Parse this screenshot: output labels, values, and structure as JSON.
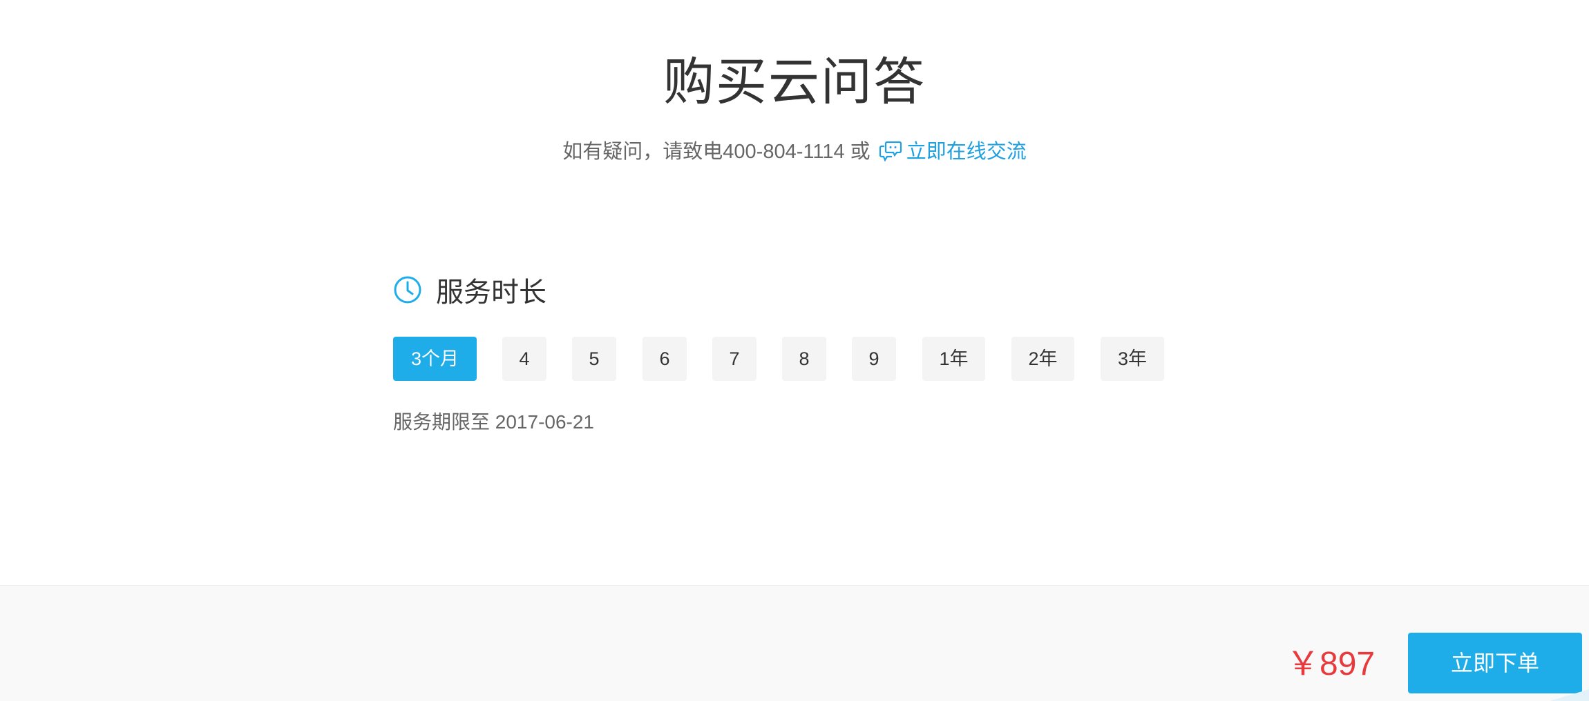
{
  "page": {
    "title": "购买云问答",
    "contact_prefix": "如有疑问，请致电400-804-1114 或",
    "chat_link": "立即在线交流"
  },
  "duration": {
    "heading": "服务时长",
    "options": [
      {
        "label": "3个月",
        "selected": true
      },
      {
        "label": "4",
        "selected": false
      },
      {
        "label": "5",
        "selected": false
      },
      {
        "label": "6",
        "selected": false
      },
      {
        "label": "7",
        "selected": false
      },
      {
        "label": "8",
        "selected": false
      },
      {
        "label": "9",
        "selected": false
      },
      {
        "label": "1年",
        "selected": false
      },
      {
        "label": "2年",
        "selected": false
      },
      {
        "label": "3年",
        "selected": false
      }
    ],
    "expiry_text": "服务期限至 2017-06-21"
  },
  "footer": {
    "price": "￥897",
    "order_button": "立即下单"
  },
  "colors": {
    "accent": "#1fadea",
    "price": "#e8393d",
    "text": "#333333",
    "muted": "#666666"
  },
  "icons": {
    "chat": "chat-bubble-icon",
    "clock": "clock-icon"
  }
}
